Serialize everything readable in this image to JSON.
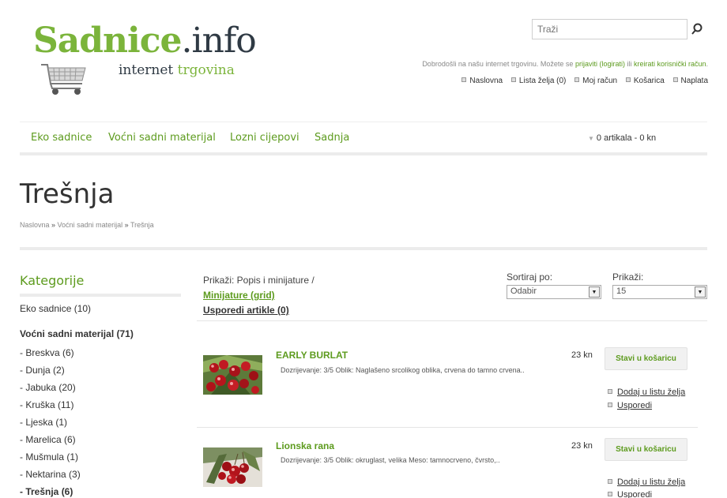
{
  "header": {
    "logo_main_green": "Sadnice",
    "logo_main_dark": ".info",
    "logo_sub_dark": "internet ",
    "logo_sub_green": "trgovina",
    "search_placeholder": "Traži",
    "welcome_prefix": "Dobrodošli na našu internet trgovinu. Možete se ",
    "welcome_login": "prijaviti (logirati)",
    "welcome_or": " ili ",
    "welcome_register": "kreirati korisnički račun",
    "welcome_suffix": ".",
    "top_links": [
      "Naslovna",
      "Lista želja (0)",
      "Moj račun",
      "Košarica",
      "Naplata"
    ]
  },
  "nav": {
    "items": [
      "Eko sadnice",
      "Voćni sadni materijal",
      "Lozni cijepovi",
      "Sadnja"
    ],
    "cart_summary": "0 artikala - 0 kn"
  },
  "page": {
    "title": "Trešnja",
    "breadcrumb": [
      "Naslovna",
      "Voćni sadni materijal",
      "Trešnja"
    ],
    "breadcrumb_sep": " » "
  },
  "sidebar": {
    "title": "Kategorije",
    "items": [
      "Eko sadnice (10)",
      "Voćni sadni materijal (71)",
      "- Breskva (6)",
      "- Dunja (2)",
      "- Jabuka (20)",
      "- Kruška (11)",
      "- Ljeska (1)",
      "- Marelica (6)",
      "- Mušmula (1)",
      "- Nektarina (3)",
      "- Trešnja (6)"
    ]
  },
  "toolbar": {
    "show_label": "Prikaži: Popis i minijature /",
    "grid_link": "Minijature (grid)",
    "compare_link": "Usporedi artikle (0)",
    "sort_label": "Sortiraj po:",
    "sort_value": "Odabir",
    "limit_label": "Prikaži:",
    "limit_value": "15"
  },
  "products": [
    {
      "name": "EARLY BURLAT",
      "desc": "Dozrijevanje: 3/5 Oblik: Naglašeno srcolikog oblika, crvena do tamno crvena..",
      "price": "23 kn",
      "cart_label": "Stavi u košaricu",
      "wishlist_label": "Dodaj u listu želja",
      "compare_label": "Usporedi"
    },
    {
      "name": "Lionska rana",
      "desc": "Dozrijevanje: 3/5 Oblik: okruglast, velika Meso: tamnocrveno, čvrsto,..",
      "price": "23 kn",
      "cart_label": "Stavi u košaricu",
      "wishlist_label": "Dodaj u listu želja",
      "compare_label": "Usporedi"
    }
  ],
  "colors": {
    "brand_green": "#7bb43b",
    "link_green": "#5d9b1e",
    "cherry_red": "#b3141b"
  }
}
